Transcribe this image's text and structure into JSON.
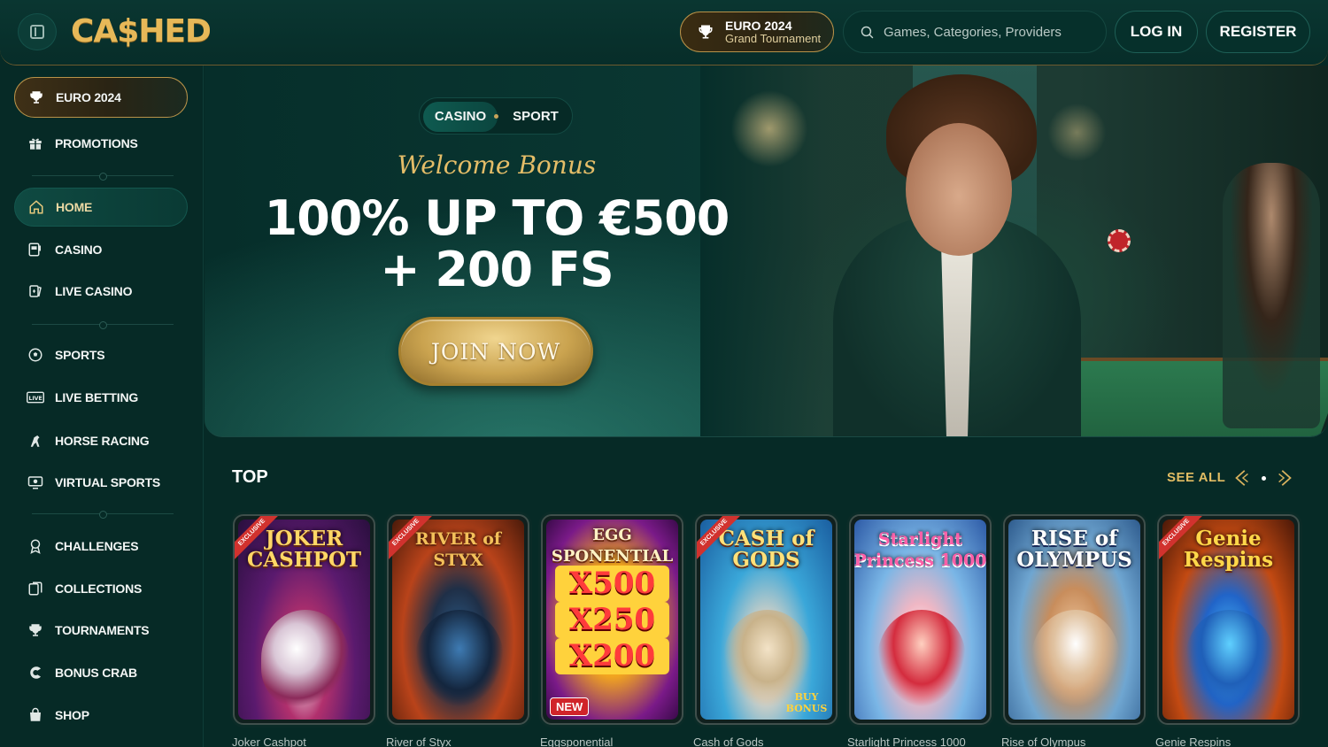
{
  "header": {
    "logo": "CA$HED",
    "euro_title": "EURO 2024",
    "euro_subtitle": "Grand Tournament",
    "search_placeholder": "Games, Categories, Providers",
    "login": "LOG IN",
    "register": "REGISTER"
  },
  "sidebar": {
    "items": [
      {
        "label": "EURO 2024",
        "icon": "trophy-icon"
      },
      {
        "label": "PROMOTIONS",
        "icon": "gift-icon"
      },
      {
        "label": "HOME",
        "icon": "home-icon"
      },
      {
        "label": "CASINO",
        "icon": "slot-machine-icon"
      },
      {
        "label": "LIVE CASINO",
        "icon": "cards-icon"
      },
      {
        "label": "SPORTS",
        "icon": "football-icon"
      },
      {
        "label": "LIVE BETTING",
        "icon": "live-icon"
      },
      {
        "label": "HORSE RACING",
        "icon": "horse-icon"
      },
      {
        "label": "VIRTUAL SPORTS",
        "icon": "monitor-icon"
      },
      {
        "label": "CHALLENGES",
        "icon": "medal-icon"
      },
      {
        "label": "COLLECTIONS",
        "icon": "collection-icon"
      },
      {
        "label": "TOURNAMENTS",
        "icon": "trophy-icon"
      },
      {
        "label": "BONUS CRAB",
        "icon": "crab-icon"
      },
      {
        "label": "SHOP",
        "icon": "shopping-bag-icon"
      }
    ]
  },
  "hero": {
    "tabs": [
      "CASINO",
      "SPORT"
    ],
    "welcome": "Welcome Bonus",
    "offer_line1": "100% UP TO €500",
    "offer_line2": "+ 200 FS",
    "cta": "JOIN NOW"
  },
  "top": {
    "title": "TOP",
    "see_all": "SEE ALL",
    "games": [
      {
        "name": "Joker Cashpot",
        "art": "JOKER CASHPOT",
        "exclusive": "EXCLUSIVE"
      },
      {
        "name": "River of Styx",
        "art": "RIVER of STYX",
        "exclusive": "EXCLUSIVE"
      },
      {
        "name": "Eggsponential",
        "art": "EGG SPONENTIAL",
        "multipliers": [
          "X500",
          "X250",
          "X200"
        ],
        "badge": "NEW"
      },
      {
        "name": "Cash of Gods",
        "art": "CASH of GODS",
        "exclusive": "EXCLUSIVE",
        "extra": "BUY BONUS"
      },
      {
        "name": "Starlight Princess 1000",
        "art": "Starlight Princess 1000"
      },
      {
        "name": "Rise of Olympus",
        "art": "RISE of OLYMPUS"
      },
      {
        "name": "Genie Respins",
        "art": "Genie Respins",
        "exclusive": "EXCLUSIVE"
      }
    ]
  },
  "colors": {
    "background": "#062a26",
    "gold": "#e1bc63",
    "accent_green": "#0f5a50"
  }
}
